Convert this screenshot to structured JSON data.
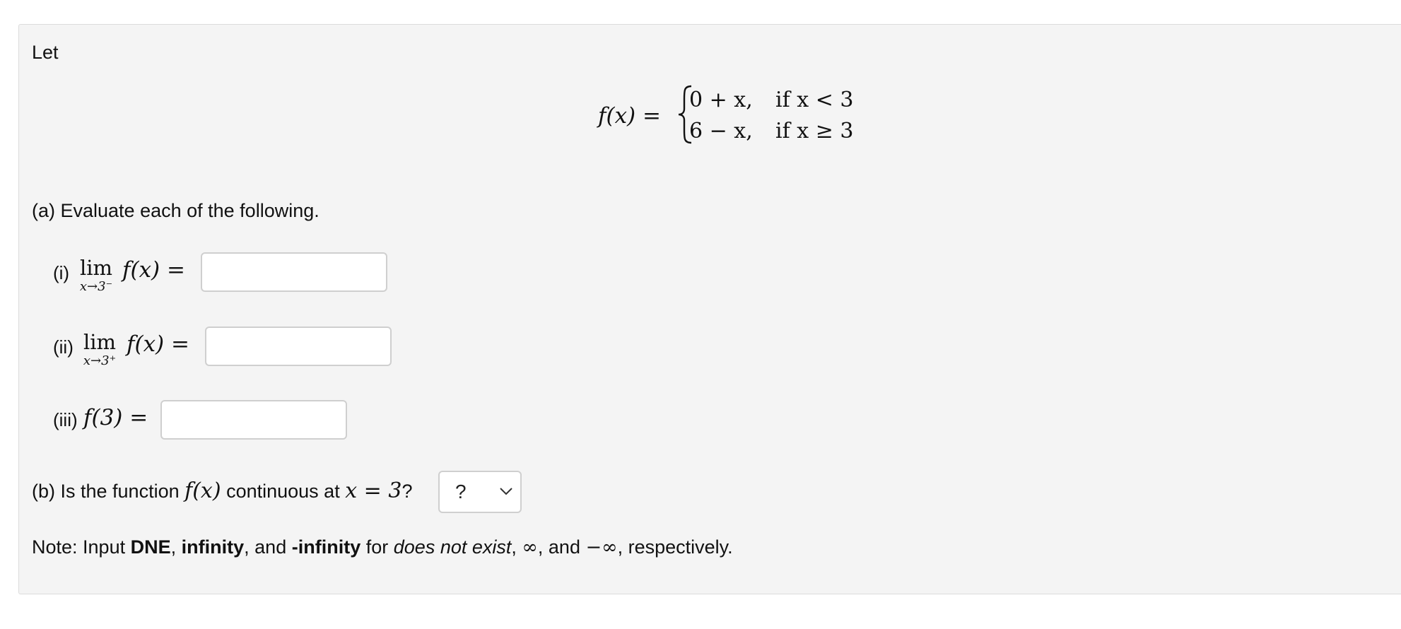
{
  "intro": {
    "let": "Let"
  },
  "function_def": {
    "lhs": "f(x) =",
    "cases": [
      {
        "expr": "0 + x,",
        "cond": "if x < 3"
      },
      {
        "expr": "6 − x,",
        "cond": "if x ≥ 3"
      }
    ]
  },
  "part_a": {
    "heading": "(a) Evaluate each of the following.",
    "items": [
      {
        "label": "(i)",
        "lim": "lim",
        "sub": "x→3⁻",
        "expr": "f(x) =",
        "value": ""
      },
      {
        "label": "(ii)",
        "lim": "lim",
        "sub": "x→3⁺",
        "expr": "f(x) =",
        "value": ""
      },
      {
        "label": "(iii)",
        "expr": "f(3) =",
        "value": ""
      }
    ]
  },
  "part_b": {
    "prefix": "(b) Is the function",
    "fx": "f(x)",
    "middle": "continuous at",
    "condition": "x = 3",
    "qmark": "?",
    "select_value": "?"
  },
  "note": {
    "prefix": "Note: Input",
    "dne": "DNE",
    "comma1": ",",
    "infinity": "infinity",
    "and1": ", and",
    "neg_infinity": "-infinity",
    "for": "for",
    "does_not_exist": "does not exist",
    "sep": ",",
    "inf_symbol": "∞",
    "and2": ", and",
    "neg_inf_symbol": "−∞",
    "suffix": ", respectively."
  }
}
